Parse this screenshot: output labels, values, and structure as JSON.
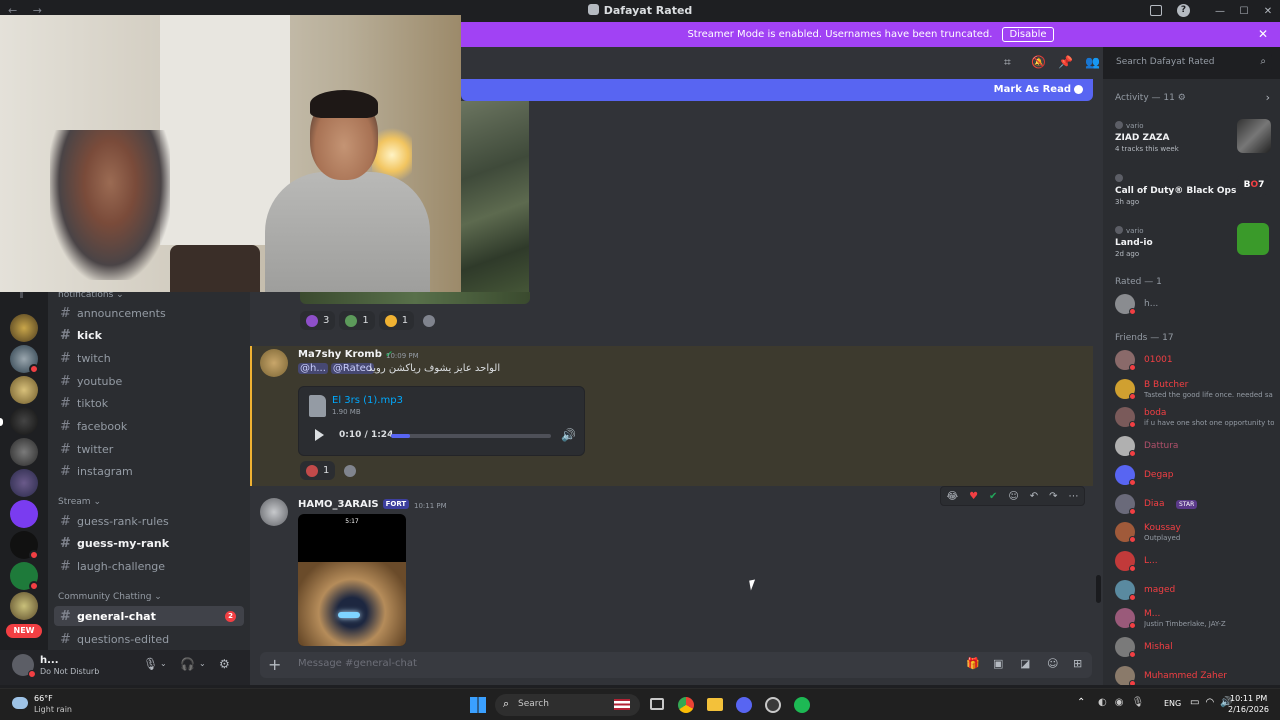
{
  "window": {
    "title": "Dafayat Rated",
    "nav_glyphs": "← →"
  },
  "banner": {
    "text": "Streamer Mode is enabled. Usernames have been truncated.",
    "button": "Disable"
  },
  "search": {
    "placeholder": "Search Dafayat Rated"
  },
  "mark_read": {
    "label": "Mark As Read"
  },
  "rail": {
    "new_label": "NEW"
  },
  "sidebar": {
    "top_category": "notifications",
    "channels_a": [
      {
        "name": "announcements",
        "bold": false
      },
      {
        "name": "kick",
        "bold": true
      },
      {
        "name": "twitch",
        "bold": false
      },
      {
        "name": "youtube",
        "bold": false
      },
      {
        "name": "tiktok",
        "bold": false
      },
      {
        "name": "facebook",
        "bold": false
      },
      {
        "name": "twitter",
        "bold": false
      },
      {
        "name": "instagram",
        "bold": false
      }
    ],
    "stream_category": "Stream",
    "channels_b": [
      {
        "name": "guess-rank-rules",
        "bold": false
      },
      {
        "name": "guess-my-rank",
        "bold": true
      },
      {
        "name": "laugh-challenge",
        "bold": false
      }
    ],
    "community_category": "Community Chatting",
    "active_channel": "general-chat",
    "active_badge": "2",
    "last_channel": "questions-edited"
  },
  "user": {
    "name": "h...",
    "status": "Do Not Disturb"
  },
  "messages": {
    "first_reactions": [
      "3",
      "1",
      "1"
    ],
    "msg2": {
      "author": "Ma7shy Kromb",
      "time": "10:09 PM",
      "mentions": [
        "@h...",
        "@Rated"
      ],
      "text": "الواحد عايز يشوف رياكشن رويد",
      "file_name": "El 3rs (1).mp3",
      "file_size": "1.90 MB",
      "time_display": "0:10 / 1:24",
      "progress": 0.12,
      "reaction_count": "1"
    },
    "msg3": {
      "author": "HAMO_3ARAIS",
      "role": "FORT",
      "time": "10:11 PM",
      "video_top": "5:17"
    }
  },
  "composer": {
    "placeholder": "Message #general-chat"
  },
  "right": {
    "activity_header": "Activity — 11",
    "activity": [
      {
        "who": "vario",
        "name": "ZIAD ZAZA",
        "sub": "4 tracks this week"
      },
      {
        "who": "",
        "name": "Call of Duty® Black Ops 7",
        "sub": "3h ago"
      },
      {
        "who": "vario",
        "name": "Land-io",
        "sub": "2d ago"
      }
    ],
    "rated_header": "Rated — 1",
    "rated_member": "h...",
    "friends_header": "Friends — 17",
    "friends": [
      {
        "name": "01001",
        "sub": "",
        "color": "#f23f43"
      },
      {
        "name": "B Butcher",
        "sub": "Tasted the good life once. needed sa",
        "color": "#f23f43"
      },
      {
        "name": "boda",
        "sub": "if u have one shot one opportunity to",
        "color": "#f23f43"
      },
      {
        "name": "Dattura",
        "sub": "",
        "color": "#b0506a"
      },
      {
        "name": "Degap",
        "sub": "",
        "color": "#f23f43"
      },
      {
        "name": "Diaa",
        "sub": "",
        "color": "#f23f43",
        "tag": "STAR"
      },
      {
        "name": "Koussay",
        "sub": "Outplayed",
        "color": "#f23f43"
      },
      {
        "name": "L...",
        "sub": "",
        "color": "#f23f43"
      },
      {
        "name": "maged",
        "sub": "",
        "color": "#f23f43"
      },
      {
        "name": "M...",
        "sub": "Justin Timberlake, JAY-Z",
        "color": "#f23f43"
      },
      {
        "name": "Mishal",
        "sub": "",
        "color": "#f23f43"
      },
      {
        "name": "Muhammed Zaher",
        "sub": "",
        "color": "#f23f43"
      }
    ]
  },
  "taskbar": {
    "weather_temp": "66°F",
    "weather_desc": "Light rain",
    "search": "Search",
    "lang": "ENG",
    "time": "10:11 PM",
    "date": "2/16/2026"
  }
}
